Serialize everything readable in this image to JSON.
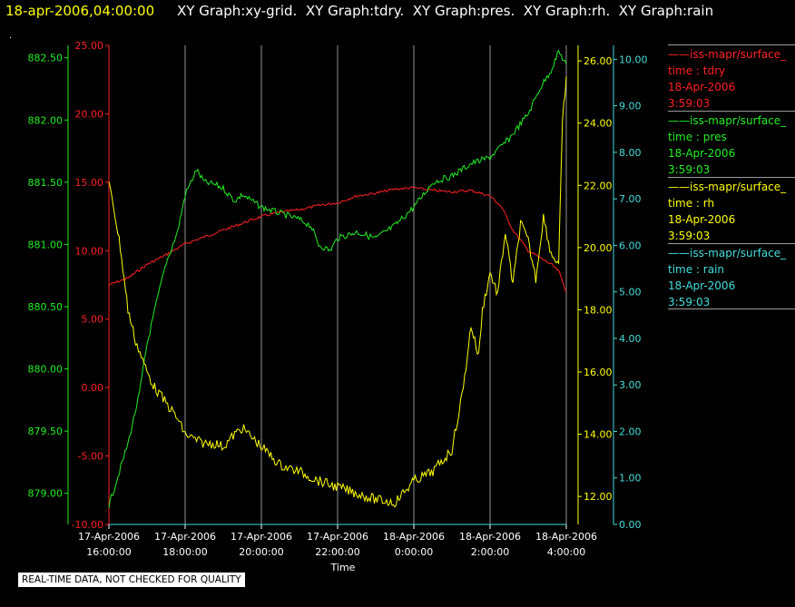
{
  "header": {
    "datetime": "18-apr-2006,04:00:00",
    "graph_titles": [
      "XY Graph:xy-grid.",
      "XY Graph:tdry.",
      "XY Graph:pres.",
      "XY Graph:rh.",
      "XY Graph:rain"
    ]
  },
  "marker": ".",
  "legend": [
    {
      "source": "——iss-mapr/surface_",
      "field": "time : tdry",
      "date": "18-Apr-2006",
      "time": "3:59:03",
      "color": "#ff2020"
    },
    {
      "source": "——iss-mapr/surface_",
      "field": "time : pres",
      "date": "18-Apr-2006",
      "time": "3:59:03",
      "color": "#22ee22"
    },
    {
      "source": "——iss-mapr/surface_",
      "field": "time : rh",
      "date": "18-Apr-2006",
      "time": "3:59:03",
      "color": "#ffff00"
    },
    {
      "source": "——iss-mapr/surface_",
      "field": "time : rain",
      "date": "18-Apr-2006",
      "time": "3:59:03",
      "color": "#44dddd"
    }
  ],
  "disclaimer": "REAL-TIME DATA, NOT CHECKED FOR QUALITY",
  "chart_data": {
    "type": "line",
    "xlabel": "Time",
    "x_ticks": [
      {
        "date": "17-Apr-2006",
        "time": "16:00:00"
      },
      {
        "date": "17-Apr-2006",
        "time": "18:00:00"
      },
      {
        "date": "17-Apr-2006",
        "time": "20:00:00"
      },
      {
        "date": "17-Apr-2006",
        "time": "22:00:00"
      },
      {
        "date": "18-Apr-2006",
        "time": "0:00:00"
      },
      {
        "date": "18-Apr-2006",
        "time": "2:00:00"
      },
      {
        "date": "18-Apr-2006",
        "time": "4:00:00"
      }
    ],
    "xlim": [
      "17-Apr-2006 16:00:00",
      "18-Apr-2006 4:00:00"
    ],
    "grid": "vertical",
    "axes": {
      "pres": {
        "color": "#22ee22",
        "ylim": [
          878.75,
          882.6
        ],
        "ticks": [
          "879.00",
          "879.50",
          "880.00",
          "880.50",
          "881.00",
          "881.50",
          "882.00",
          "882.50"
        ]
      },
      "tdry": {
        "color": "#ff2020",
        "ylim": [
          -10,
          25
        ],
        "ticks": [
          "-10.00",
          "-5.00",
          "0.00",
          "5.00",
          "10.00",
          "15.00",
          "20.00",
          "25.00"
        ]
      },
      "rh": {
        "color": "#ffff00",
        "ylim": [
          11.1,
          26.5
        ],
        "ticks": [
          "12.00",
          "14.00",
          "16.00",
          "18.00",
          "20.00",
          "22.00",
          "24.00",
          "26.00"
        ]
      },
      "rain": {
        "color": "#44dddd",
        "ylim": [
          0,
          10.3
        ],
        "ticks": [
          "0.00",
          "1.00",
          "2.00",
          "3.00",
          "4.00",
          "5.00",
          "6.00",
          "7.00",
          "8.00",
          "9.00",
          "10.00"
        ]
      }
    },
    "series": [
      {
        "name": "tdry",
        "axis": "tdry",
        "color": "#ff2020",
        "x": [
          0,
          0.5,
          1,
          1.5,
          2,
          2.5,
          3,
          3.5,
          4,
          4.5,
          5,
          5.5,
          6,
          6.5,
          7,
          7.5,
          8,
          8.5,
          9,
          9.5,
          10,
          10.3,
          10.6,
          11,
          11.3,
          11.6,
          11.8,
          12
        ],
        "y": [
          7.5,
          8,
          9,
          9.7,
          10.5,
          11,
          11.5,
          12,
          12.5,
          12.8,
          13,
          13.3,
          13.5,
          14,
          14.2,
          14.5,
          14.6,
          14.4,
          14.3,
          14.4,
          14,
          13.2,
          11.5,
          10,
          9.5,
          9,
          8.5,
          7
        ]
      },
      {
        "name": "pres",
        "axis": "pres",
        "color": "#22ee22",
        "x": [
          0,
          0.2,
          0.5,
          0.8,
          1,
          1.3,
          1.5,
          1.8,
          2,
          2.3,
          2.5,
          2.8,
          3,
          3.3,
          3.5,
          4,
          4.5,
          5,
          5.3,
          5.5,
          5.8,
          6,
          6.5,
          7,
          7.5,
          8,
          8.5,
          9,
          9.5,
          10,
          10.5,
          11,
          11.3,
          11.6,
          11.8,
          12
        ],
        "y": [
          878.9,
          879.1,
          879.4,
          879.8,
          880.2,
          880.6,
          880.85,
          881.1,
          881.4,
          881.6,
          881.5,
          881.48,
          881.45,
          881.35,
          881.4,
          881.3,
          881.25,
          881.2,
          881.15,
          881.0,
          880.95,
          881.05,
          881.1,
          881.05,
          881.15,
          881.3,
          881.5,
          881.55,
          881.65,
          881.7,
          881.85,
          882.05,
          882.25,
          882.4,
          882.55,
          882.45
        ]
      },
      {
        "name": "rh",
        "axis": "rh",
        "color": "#ffff00",
        "x": [
          0,
          0.1,
          0.3,
          0.5,
          0.7,
          1,
          1.2,
          1.5,
          1.8,
          2,
          2.3,
          2.5,
          2.8,
          3,
          3.3,
          3.5,
          4,
          4.5,
          5,
          5.5,
          6,
          6.5,
          7,
          7.5,
          8,
          8.5,
          9,
          9.3,
          9.5,
          9.7,
          9.8,
          10,
          10.2,
          10.4,
          10.6,
          10.8,
          11,
          11.2,
          11.4,
          11.6,
          11.8,
          11.9,
          12
        ],
        "y": [
          22,
          21.5,
          20,
          18,
          17,
          16,
          15.5,
          15,
          14.5,
          14,
          13.8,
          13.7,
          13.7,
          13.6,
          14,
          14.2,
          13.6,
          13,
          12.8,
          12.5,
          12.3,
          12.1,
          11.9,
          11.8,
          12.5,
          12.8,
          13.5,
          15.5,
          17.5,
          16.5,
          18,
          19.2,
          18.5,
          20.5,
          18.8,
          20.8,
          20.2,
          19,
          21,
          19.8,
          19.5,
          24,
          25.5
        ]
      },
      {
        "name": "rain",
        "axis": "rain",
        "color": "#44dddd",
        "x": [
          0,
          12
        ],
        "y": [
          0,
          0
        ]
      }
    ]
  }
}
